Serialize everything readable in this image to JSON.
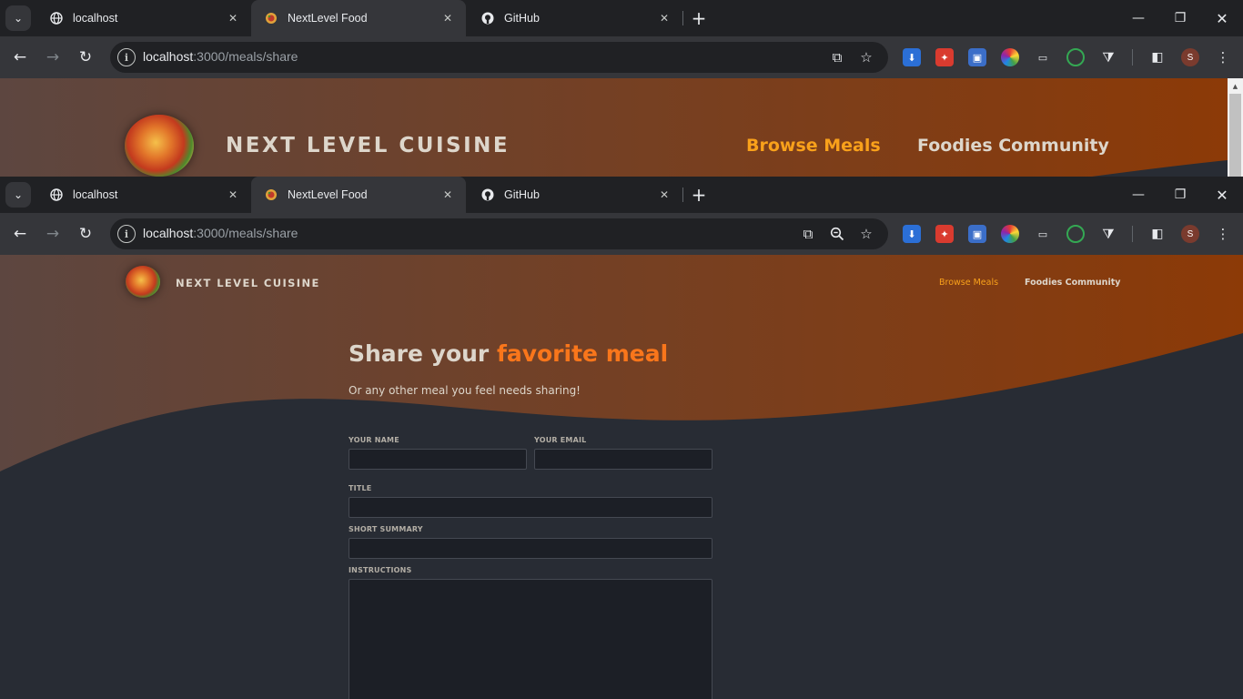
{
  "browser": {
    "tabs": [
      {
        "title": "localhost",
        "favicon": "globe-icon",
        "active": false
      },
      {
        "title": "NextLevel Food",
        "favicon": "food-plate-icon",
        "active": true
      },
      {
        "title": "GitHub",
        "favicon": "github-icon",
        "active": false
      }
    ],
    "url_host": "localhost",
    "url_path": ":3000/meals/share",
    "profile_initial": "S",
    "extensions": [
      "download-extension-icon",
      "red-extension-icon",
      "screen-capture-extension-icon",
      "color-wheel-extension-icon",
      "cast-icon",
      "target-extension-icon",
      "puzzle-extensions-icon"
    ]
  },
  "site": {
    "brand": "NEXT LEVEL CUISINE",
    "nav": {
      "browse": "Browse Meals",
      "community": "Foodies Community"
    }
  },
  "page": {
    "title_main": "Share your ",
    "title_accent": "favorite meal",
    "subtitle": "Or any other meal you feel needs sharing!"
  },
  "form": {
    "name_label": "Your name",
    "email_label": "Your email",
    "title_label": "Title",
    "summary_label": "Short Summary",
    "instructions_label": "Instructions",
    "name_value": "",
    "email_value": "",
    "title_value": "",
    "summary_value": "",
    "instructions_value": ""
  },
  "colors": {
    "accent": "#f9761b",
    "nav_active": "#f9a11b",
    "header_gradient_start": "#5d4640",
    "header_gradient_end": "#8c3a07",
    "page_bg": "#282c34"
  }
}
